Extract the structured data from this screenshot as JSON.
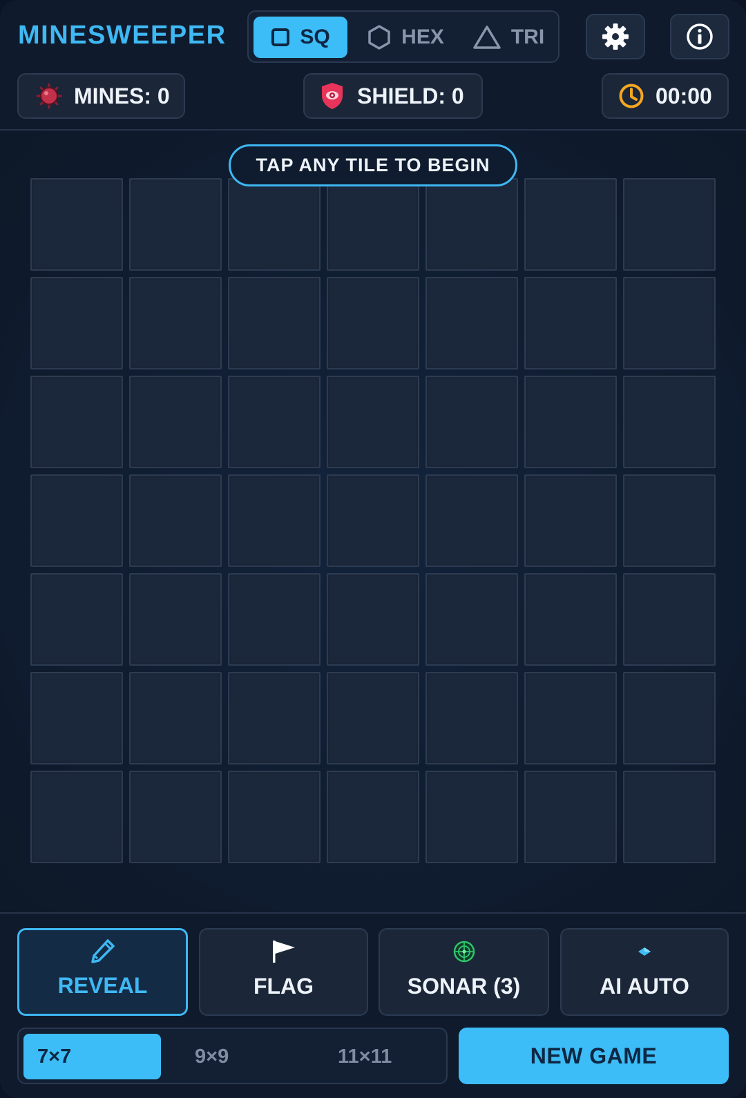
{
  "header": {
    "title": "MINESWEEPER",
    "modes": [
      {
        "label": "SQ",
        "icon": "square-icon",
        "active": true
      },
      {
        "label": "HEX",
        "icon": "hexagon-icon",
        "active": false
      },
      {
        "label": "TRI",
        "icon": "triangle-icon",
        "active": false
      }
    ],
    "settings_icon": "gear-icon",
    "info_icon": "info-icon"
  },
  "stats": {
    "mines": "MINES: 0",
    "shield": "SHIELD: 0",
    "time": "00:00"
  },
  "board": {
    "prompt": "TAP ANY TILE TO BEGIN",
    "rows": 7,
    "cols": 7
  },
  "tools": [
    {
      "label": "REVEAL",
      "icon": "pencil-icon",
      "active": true
    },
    {
      "label": "FLAG",
      "icon": "flag-icon",
      "active": false
    },
    {
      "label": "SONAR (3)",
      "icon": "radar-icon",
      "active": false
    },
    {
      "label": "AI AUTO",
      "icon": "diamond-icon",
      "active": false
    }
  ],
  "sizes": [
    {
      "label": "7×7",
      "active": true
    },
    {
      "label": "9×9",
      "active": false
    },
    {
      "label": "11×11",
      "active": false
    }
  ],
  "new_game_label": "NEW GAME",
  "colors": {
    "accent": "#3dbdf7",
    "background": "#0f1a2c",
    "tile": "#1b283c",
    "mine": "#c2304a",
    "shield": "#e8345a",
    "timer": "#f5a623",
    "sonar": "#2fc46b"
  }
}
